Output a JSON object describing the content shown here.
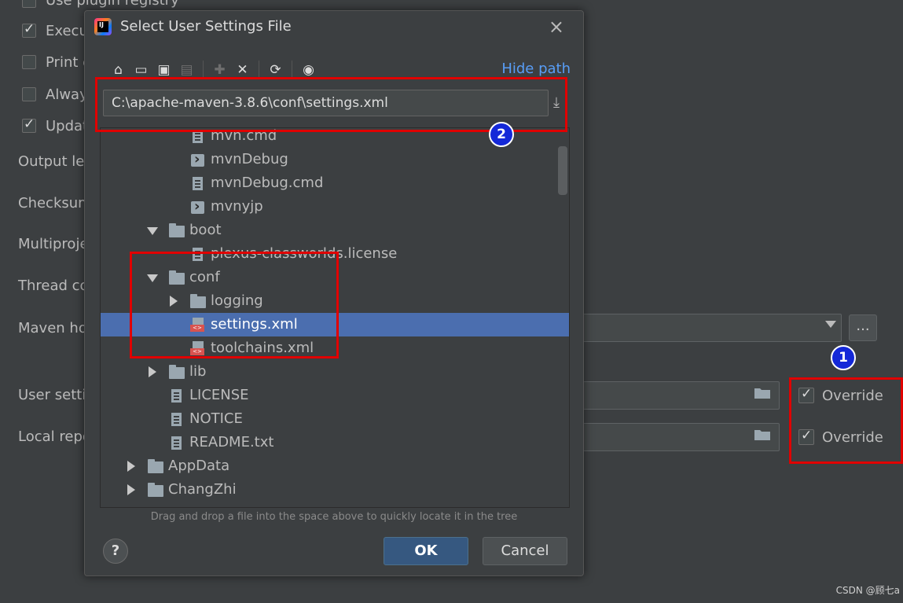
{
  "background": {
    "checkboxes": [
      {
        "label": "Use plugin registry",
        "checked": false
      },
      {
        "label": "Execu",
        "checked": true
      },
      {
        "label": "Print e",
        "checked": false
      },
      {
        "label": "Alway",
        "checked": false
      },
      {
        "label": "Updat",
        "checked": true
      }
    ],
    "labels": [
      "Output le",
      "Checksum",
      "Multiproje",
      "Thread co",
      "Maven ho",
      "User settin",
      "Local repo"
    ],
    "maven_home_more_button": "...",
    "override_user_settings": {
      "label": "Override",
      "checked": true
    },
    "override_local_repo": {
      "label": "Override",
      "checked": true
    }
  },
  "dialog": {
    "title": "Select User Settings File",
    "app_icon_text": "IJ",
    "close_icon": "×",
    "toolbar_icons": {
      "home": "⌂",
      "desktop": "▭",
      "project": "▣",
      "module": "▤",
      "new_folder": "✚",
      "delete": "✕",
      "refresh": "⟳",
      "show_hidden": "◉"
    },
    "hide_path_link": "Hide path",
    "path": "C:\\apache-maven-3.8.6\\conf\\settings.xml",
    "download_icon": "⤓",
    "tree": [
      {
        "label": "mvn.cmd",
        "icon": "file"
      },
      {
        "label": "mvnDebug",
        "icon": "exe"
      },
      {
        "label": "mvnDebug.cmd",
        "icon": "file"
      },
      {
        "label": "mvnyjp",
        "icon": "exe"
      },
      {
        "label": "boot",
        "icon": "folder",
        "expanded": true
      },
      {
        "label": "plexus-classworlds.license",
        "icon": "file"
      },
      {
        "label": "conf",
        "icon": "folder",
        "expanded": true
      },
      {
        "label": "logging",
        "icon": "folder",
        "expanded": false
      },
      {
        "label": "settings.xml",
        "icon": "xml",
        "selected": true
      },
      {
        "label": "toolchains.xml",
        "icon": "xml"
      },
      {
        "label": "lib",
        "icon": "folder",
        "expanded": false
      },
      {
        "label": "LICENSE",
        "icon": "file"
      },
      {
        "label": "NOTICE",
        "icon": "file"
      },
      {
        "label": "README.txt",
        "icon": "file"
      },
      {
        "label": "AppData",
        "icon": "folder",
        "expanded": false
      },
      {
        "label": "ChangZhi",
        "icon": "folder",
        "expanded": false
      }
    ],
    "hint": "Drag and drop a file into the space above to quickly locate it in the tree",
    "help_label": "?",
    "ok_label": "OK",
    "cancel_label": "Cancel"
  },
  "annotations": {
    "badge1": "1",
    "badge2": "2"
  },
  "watermark": "CSDN @顾七a",
  "colors": {
    "background": "#3c3f41",
    "selection": "#4b6eaf",
    "link": "#589df6",
    "annotation_red": "#e00000",
    "badge_blue": "#1428d8"
  }
}
